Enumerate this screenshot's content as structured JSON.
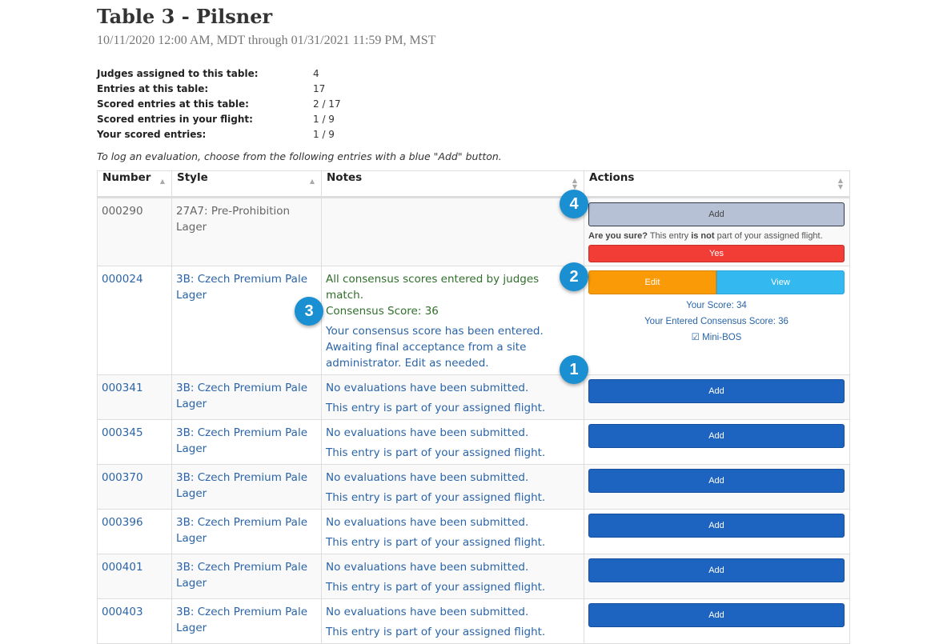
{
  "header": {
    "title": "Table 3 - Pilsner",
    "dates": "10/11/2020 12:00 AM, MDT through 01/31/2021 11:59 PM, MST"
  },
  "stats": [
    {
      "label": "Judges assigned to this table:",
      "value": "4"
    },
    {
      "label": "Entries at this table:",
      "value": "17"
    },
    {
      "label": "Scored entries at this table:",
      "value": "2 / 17"
    },
    {
      "label": "Scored entries in your flight:",
      "value": "1 / 9"
    },
    {
      "label": "Your scored entries:",
      "value": "1 / 9"
    }
  ],
  "instruction": "To log an evaluation, choose from the following entries with a blue \"Add\" button.",
  "table": {
    "headers": {
      "number": "Number",
      "style": "Style",
      "notes": "Notes",
      "actions": "Actions"
    },
    "rows": [
      {
        "number": "000290",
        "style": "27A7: Pre-Prohibition Lager",
        "add_label": "Add",
        "confirm_prefix": "Are you sure?",
        "confirm_mid": " This entry ",
        "confirm_bold": "is not",
        "confirm_suffix": " part of your assigned flight.",
        "yes_label": "Yes"
      },
      {
        "number": "000024",
        "style": "3B: Czech Premium Pale Lager",
        "note_green": "All consensus scores entered by judges match.",
        "note_score": "Consensus Score: 36",
        "note_blue": "Your consensus score has been entered. Awaiting final acceptance from a site administrator. Edit as needed.",
        "edit_label": "Edit",
        "view_label": "View",
        "your_score": "Your Score: 34",
        "consensus_score": "Your Entered Consensus Score: 36",
        "mini_bos": "Mini-BOS"
      }
    ],
    "flight_rows": [
      {
        "number": "000341",
        "style": "3B: Czech Premium Pale Lager",
        "note1": "No evaluations have been submitted.",
        "note2": "This entry is part of your assigned flight.",
        "add_label": "Add"
      },
      {
        "number": "000345",
        "style": "3B: Czech Premium Pale Lager",
        "note1": "No evaluations have been submitted.",
        "note2": "This entry is part of your assigned flight.",
        "add_label": "Add"
      },
      {
        "number": "000370",
        "style": "3B: Czech Premium Pale Lager",
        "note1": "No evaluations have been submitted.",
        "note2": "This entry is part of your assigned flight.",
        "add_label": "Add"
      },
      {
        "number": "000396",
        "style": "3B: Czech Premium Pale Lager",
        "note1": "No evaluations have been submitted.",
        "note2": "This entry is part of your assigned flight.",
        "add_label": "Add"
      },
      {
        "number": "000401",
        "style": "3B: Czech Premium Pale Lager",
        "note1": "No evaluations have been submitted.",
        "note2": "This entry is part of your assigned flight.",
        "add_label": "Add"
      },
      {
        "number": "000403",
        "style": "3B: Czech Premium Pale Lager",
        "note1": "No evaluations have been submitted.",
        "note2": "This entry is part of your assigned flight.",
        "add_label": "Add"
      }
    ]
  },
  "badges": [
    "1",
    "2",
    "3",
    "4"
  ],
  "colors": {
    "add": "#1d63c0",
    "edit": "#f99a06",
    "view": "#34b8f0",
    "yes": "#f23c36",
    "badge": "#1a8fd2"
  }
}
